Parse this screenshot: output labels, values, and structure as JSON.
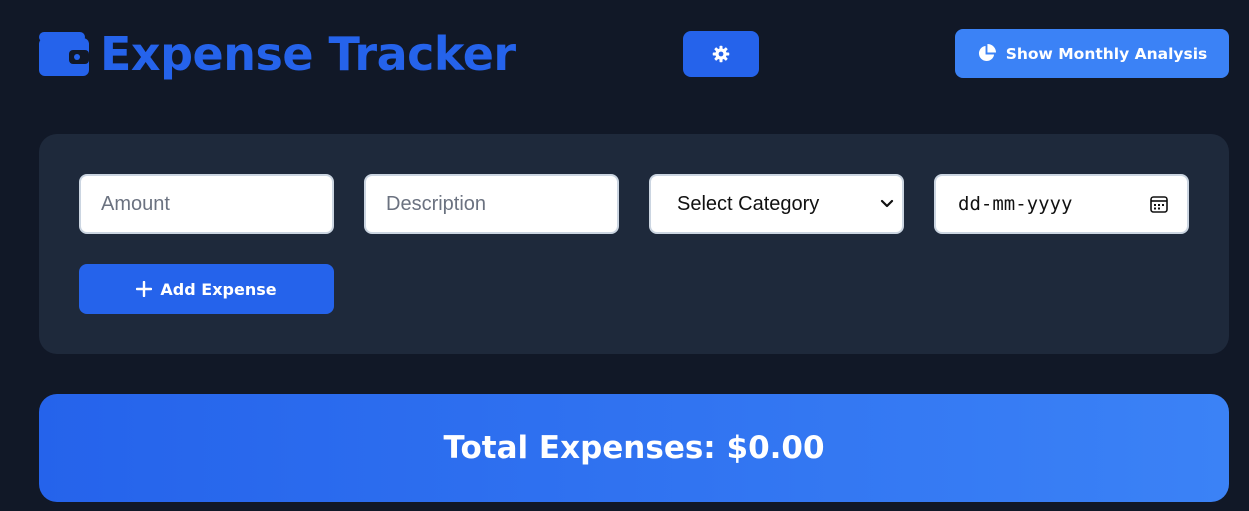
{
  "header": {
    "title": "Expense Tracker",
    "logo_icon": "wallet-icon",
    "settings_icon": "gear-icon",
    "analysis_icon": "pie-chart-icon",
    "analysis_label": "Show Monthly Analysis"
  },
  "form": {
    "amount": {
      "placeholder": "Amount",
      "value": ""
    },
    "description": {
      "placeholder": "Description",
      "value": ""
    },
    "category": {
      "selected": "Select Category",
      "icon": "chevron-down-icon"
    },
    "date": {
      "value": "dd-mm-yyyy",
      "icon": "calendar-icon"
    },
    "add_button": {
      "label": "Add Expense",
      "icon": "plus-icon"
    }
  },
  "total": {
    "label": "Total Expenses:",
    "value": "$0.00"
  },
  "colors": {
    "background": "#111827",
    "card": "#1e293b",
    "primary": "#2563eb",
    "primary_light": "#3b82f6",
    "text_light": "#ffffff"
  }
}
